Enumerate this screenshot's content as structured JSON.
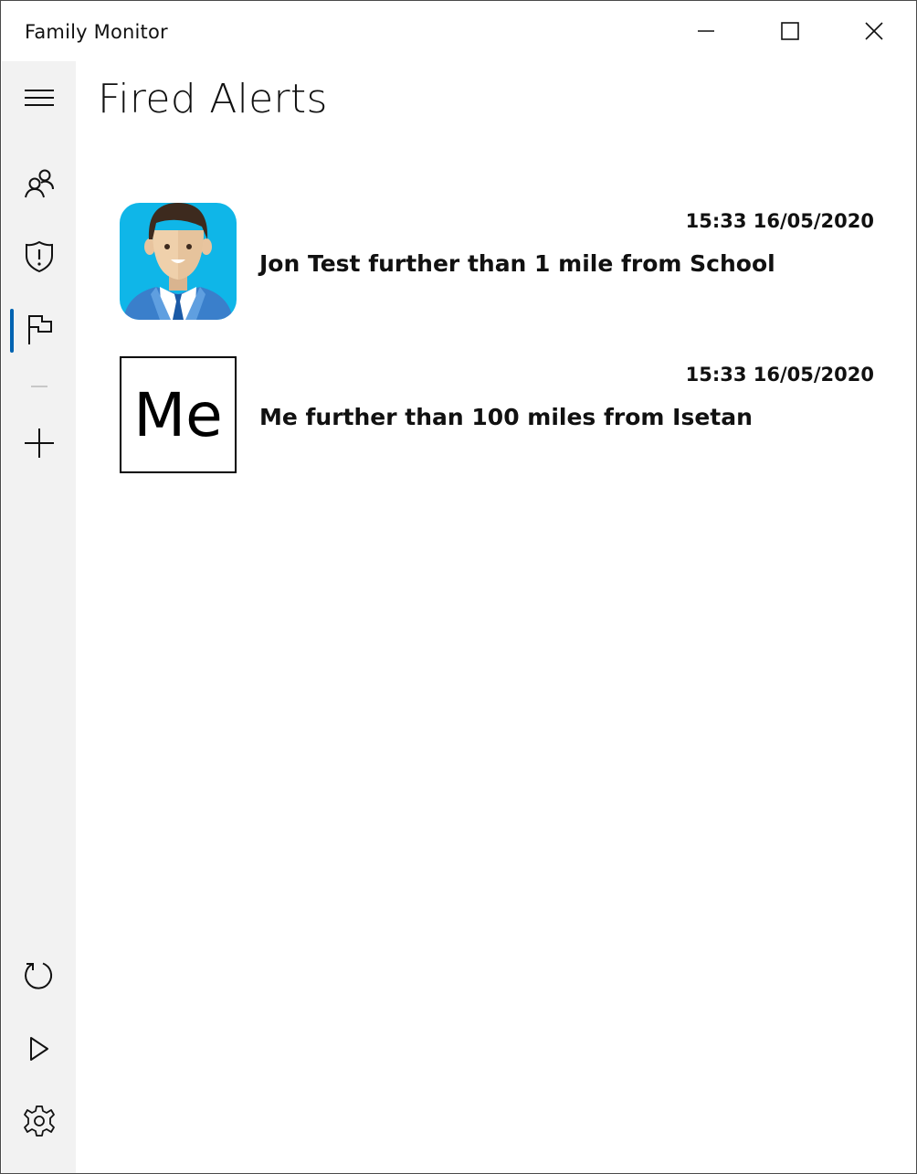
{
  "window": {
    "title": "Family Monitor"
  },
  "nav": {
    "items": [
      {
        "icon": "hamburger-menu-icon"
      },
      {
        "icon": "people-icon"
      },
      {
        "icon": "shield-alert-icon"
      },
      {
        "icon": "flag-icon",
        "selected": true
      },
      {
        "icon": "add-icon"
      },
      {
        "icon": "refresh-icon"
      },
      {
        "icon": "play-icon"
      },
      {
        "icon": "settings-gear-icon"
      }
    ],
    "accent_color": "#0063b1"
  },
  "page": {
    "title": "Fired Alerts"
  },
  "alerts": [
    {
      "time": "15:33 16/05/2020",
      "text": "Jon Test further than 1 mile from School",
      "avatar": "person-avatar-icon"
    },
    {
      "time": "15:33 16/05/2020",
      "text": "Me further than 100 miles from Isetan",
      "avatar_text": "Me"
    }
  ],
  "colors": {
    "avatar_background": "#0fb6e8"
  }
}
